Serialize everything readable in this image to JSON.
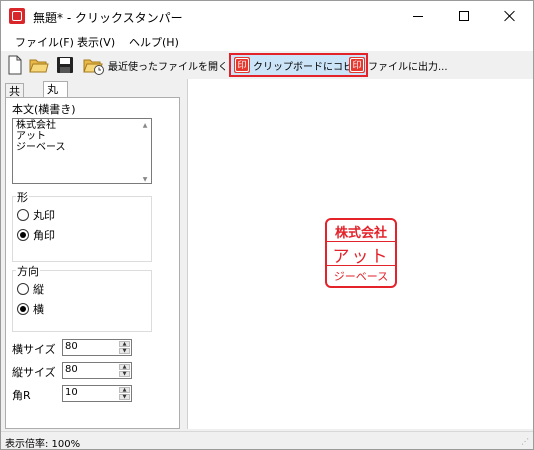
{
  "window": {
    "title": "無題* - クリックスタンパー"
  },
  "menu": {
    "items": [
      "ファイル(F)",
      "表示(V)",
      "ヘルプ(H)"
    ]
  },
  "toolbar": {
    "recent_label": "最近使ったファイルを開く...",
    "copy_label": "クリップボードにコピー",
    "export_label": "ファイルに出力..."
  },
  "tabs": {
    "common": "共通",
    "stamp": "丸印･角印"
  },
  "body_text": {
    "label": "本文(横書き)",
    "lines": [
      "株式会社",
      "アット",
      "ジーベース"
    ]
  },
  "shape": {
    "title": "形",
    "options": [
      "丸印",
      "角印"
    ],
    "selected": "角印"
  },
  "direction": {
    "title": "方向",
    "options": [
      "縦",
      "横"
    ],
    "selected": "横"
  },
  "fields": [
    {
      "label": "横サイズ",
      "value": "80"
    },
    {
      "label": "縦サイズ",
      "value": "80"
    },
    {
      "label": "角R",
      "value": "10"
    }
  ],
  "stamp_preview": {
    "lines": [
      "株式会社",
      "アット",
      "ジーベース"
    ],
    "color": "#e3222a"
  },
  "status": {
    "text": "表示倍率: 100%"
  }
}
